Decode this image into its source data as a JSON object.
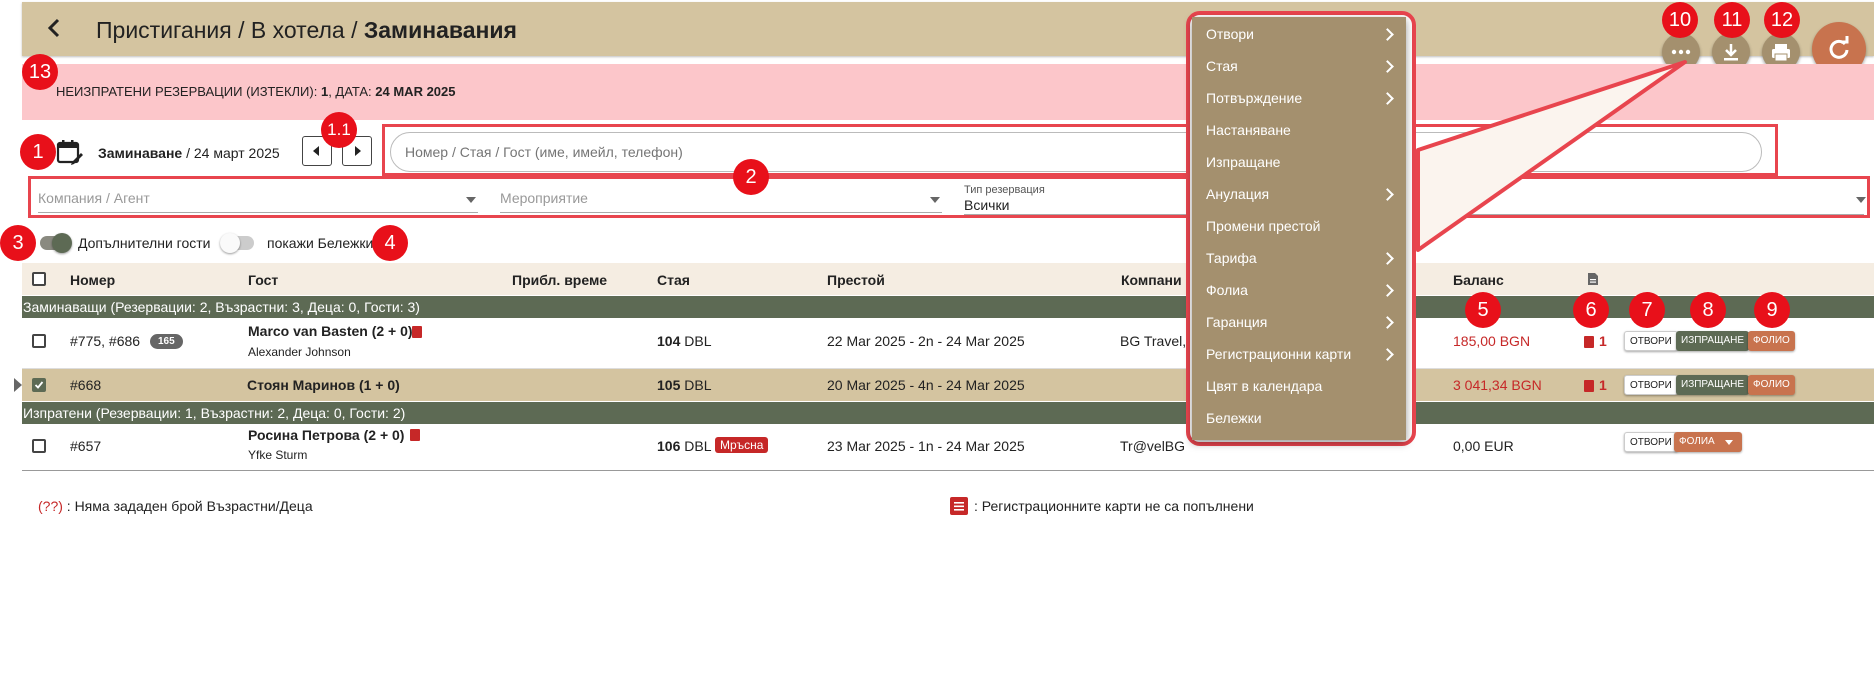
{
  "header": {
    "breadcrumb_1": "Пристигания",
    "sep_1": " / ",
    "breadcrumb_2": "В хотела",
    "sep_2": " / ",
    "title": "Заминавания"
  },
  "alert": {
    "prefix": "НЕИЗПРАТЕНИ РЕЗЕРВАЦИИ (ИЗТЕКЛИ): ",
    "count": "1",
    "mid": ", ДАТА: ",
    "date": "24 MAR 2025"
  },
  "date_nav": {
    "label": "Заминаване",
    "date": " / 24 март 2025",
    "calendar_icon": "calendar-edit-icon"
  },
  "search": {
    "placeholder": "Номер / Стая / Гост (име, имейл, телефон)"
  },
  "filters": {
    "company_placeholder": "Компания / Агент",
    "event_placeholder": "Мероприятие",
    "reservation_type_label": "Тип резервация",
    "reservation_type_value": "Всички"
  },
  "toggles": {
    "extra_guests": "Допълнителни гости",
    "show_notes": "покажи Бележки"
  },
  "table": {
    "headers": [
      "Номер",
      "Гост",
      "Прибл. време",
      "Стая",
      "Престой",
      "Компани",
      "Баланс"
    ],
    "groups": [
      "Заминаващи (Резервации: 2, Възрастни: 3, Деца: 0, Гости: 3)",
      "Изпратени (Резервации: 1, Възрастни: 2, Деца: 0, Гости: 2)"
    ],
    "rows": [
      {
        "number": "#775, #686",
        "number_badge": "165",
        "guest": "Marco van Basten (2 + 0)",
        "guest_sub": "Alexander Johnson",
        "room_num": "104",
        "room_type": " DBL",
        "stay": "22 Mar 2025 - 2n - 24 Mar 2025",
        "company": "BG Travel,",
        "balance": "185,00 BGN",
        "docs": "1",
        "btn_open": "ОТВОРИ",
        "btn_send": "ИЗПРАЩАНЕ",
        "btn_folio": "ФОЛИО"
      },
      {
        "number": "#668",
        "guest": "Стоян Маринов (1 + 0)",
        "room_num": "105",
        "room_type": " DBL",
        "stay": "20 Mar 2025 - 4n - 24 Mar 2025",
        "balance": "3 041,34 BGN",
        "docs": "1",
        "btn_open": "ОТВОРИ",
        "btn_send": "ИЗПРАЩАНЕ",
        "btn_folio": "ФОЛИО"
      },
      {
        "number": "#657",
        "guest": "Росина Петрова (2 + 0)",
        "guest_sub": "Yfke Sturm",
        "room_num": "106",
        "room_type": " DBL",
        "room_status": "Мръсна",
        "stay": "23 Mar 2025 - 1n - 24 Mar 2025",
        "company": "Tr@velBG",
        "balance": "0,00 EUR",
        "btn_open": "ОТВОРИ",
        "btn_folios": "ФОЛИА"
      }
    ]
  },
  "legend": {
    "mark": "(??)",
    "text_1": " : Няма зададен брой Възрастни/Деца",
    "text_2": ": Регистрационните карти не са попълнени"
  },
  "menu": {
    "items": [
      {
        "label": "Отвори",
        "submenu": true
      },
      {
        "label": "Стая",
        "submenu": true
      },
      {
        "label": "Потвърждение",
        "submenu": true
      },
      {
        "label": "Настаняване",
        "submenu": false
      },
      {
        "label": "Изпращане",
        "submenu": false
      },
      {
        "label": "Анулация",
        "submenu": true
      },
      {
        "label": "Промени престой",
        "submenu": false
      },
      {
        "label": "Тарифа",
        "submenu": true
      },
      {
        "label": "Фолиа",
        "submenu": true
      },
      {
        "label": "Гаранция",
        "submenu": true
      },
      {
        "label": "Регистрационни карти",
        "submenu": true
      },
      {
        "label": "Цвят в календара",
        "submenu": false
      },
      {
        "label": "Бележки",
        "submenu": false
      }
    ]
  },
  "annotations": [
    "1",
    "1.1",
    "2",
    "3",
    "4",
    "5",
    "6",
    "7",
    "8",
    "9",
    "10",
    "11",
    "12",
    "13"
  ],
  "colors": {
    "header_bg": "#d4c4a0",
    "alert_bg": "#fcc6ca",
    "group_bg": "#5d6a54",
    "menu_bg": "#a4906e",
    "annotation_red": "#e8101a",
    "folio": "#c8734e",
    "refresh": "#c8734e"
  }
}
